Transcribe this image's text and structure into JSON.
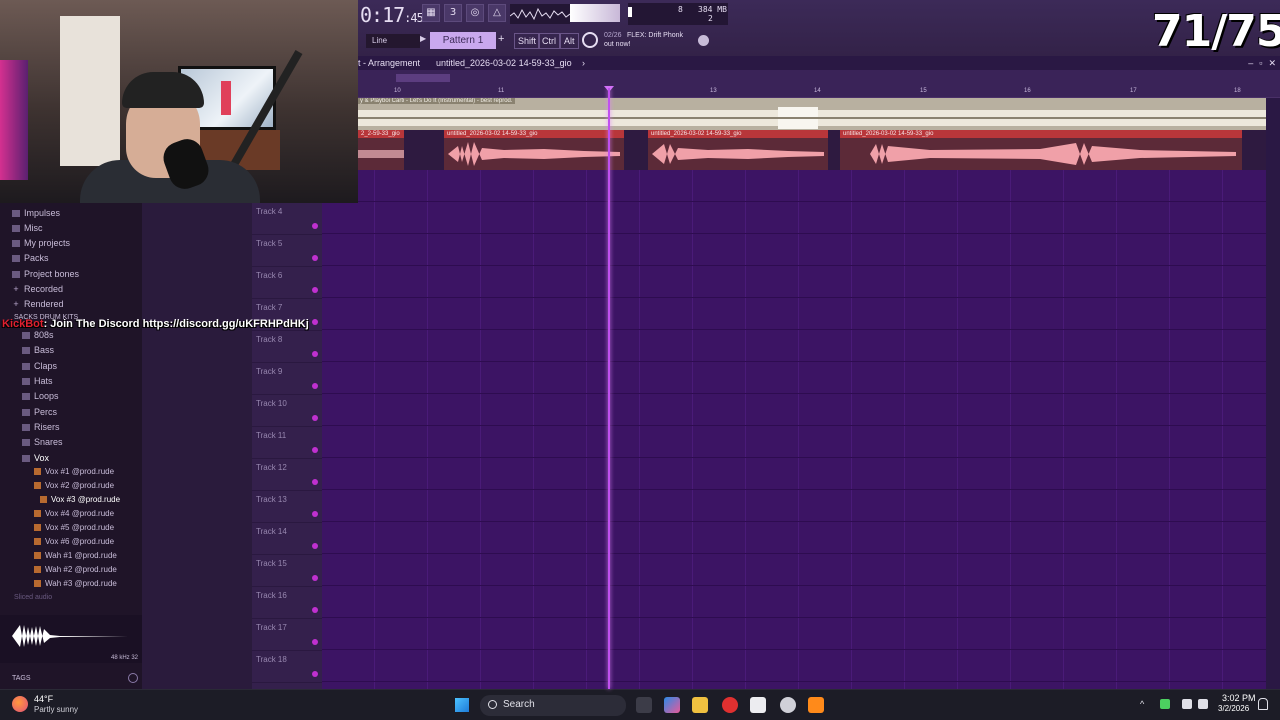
{
  "counter": "71/75",
  "toolbar": {
    "time": "0:17",
    "time_sub": ":45",
    "cpu_num": "8",
    "mem": "384 MB",
    "mem_sub": "2",
    "line_mode": "Line",
    "pattern": "Pattern 1",
    "keys": [
      "Shift",
      "Ctrl",
      "Alt"
    ],
    "news_date": "02/26",
    "news_title": "FLEX: Drift Phonk",
    "news_sub": "out now!"
  },
  "arrangement": {
    "crumb1": "t - Arrangement",
    "crumb2": "untitled_2026-03-02 14-59-33_gio",
    "crumb_sep": "›"
  },
  "ruler": {
    "marks": [
      "10",
      "11",
      "13",
      "14",
      "15",
      "16",
      "17",
      "18"
    ]
  },
  "tracks": {
    "top_label": "y & Playboi Carti - Let's Do It (Instrumental) - best reprod.",
    "clip_labels": [
      "2_2-59-33_gio",
      "untitled_2026-03-02 14-59-33_gio",
      "untitled_2026-03-02 14-59-33_gio",
      "untitled_2026-03-02 14-59-33_gio"
    ],
    "headers": [
      "Track 4",
      "Track 5",
      "Track 6",
      "Track 7",
      "Track 8",
      "Track 9",
      "Track 10",
      "Track 11",
      "Track 12",
      "Track 13",
      "Track 14",
      "Track 15",
      "Track 16",
      "Track 17",
      "Track 18"
    ]
  },
  "browser": {
    "folders_top": [
      "Impulses",
      "Misc",
      "My projects",
      "Packs",
      "Project bones",
      "Recorded",
      "Rendered"
    ],
    "pack_name": "SACKS DRUM KITS",
    "subfolders": [
      "808s",
      "Bass",
      "Claps",
      "Hats",
      "Loops",
      "Percs",
      "Risers",
      "Snares",
      "Vox"
    ],
    "vox_files": [
      "Vox #1 @prod.rude",
      "Vox #2 @prod.rude",
      "Vox #3 @prod.rude",
      "Vox #4 @prod.rude",
      "Vox #5 @prod.rude",
      "Vox #6 @prod.rude",
      "Wah #1 @prod.rude",
      "Wah #2 @prod.rude",
      "Wah #3 @prod.rude"
    ],
    "sliced": "Sliced audio",
    "sample_rate": "48 kHz 32",
    "tags_label": "TAGS"
  },
  "chat": {
    "user": "KickBot",
    "message": ": Join The Discord https://discord.gg/uKFRHPdHKj"
  },
  "taskbar": {
    "temp": "44°F",
    "weather": "Partly sunny",
    "search": "Search",
    "time": "3:02 PM",
    "date": "3/2/2026"
  }
}
